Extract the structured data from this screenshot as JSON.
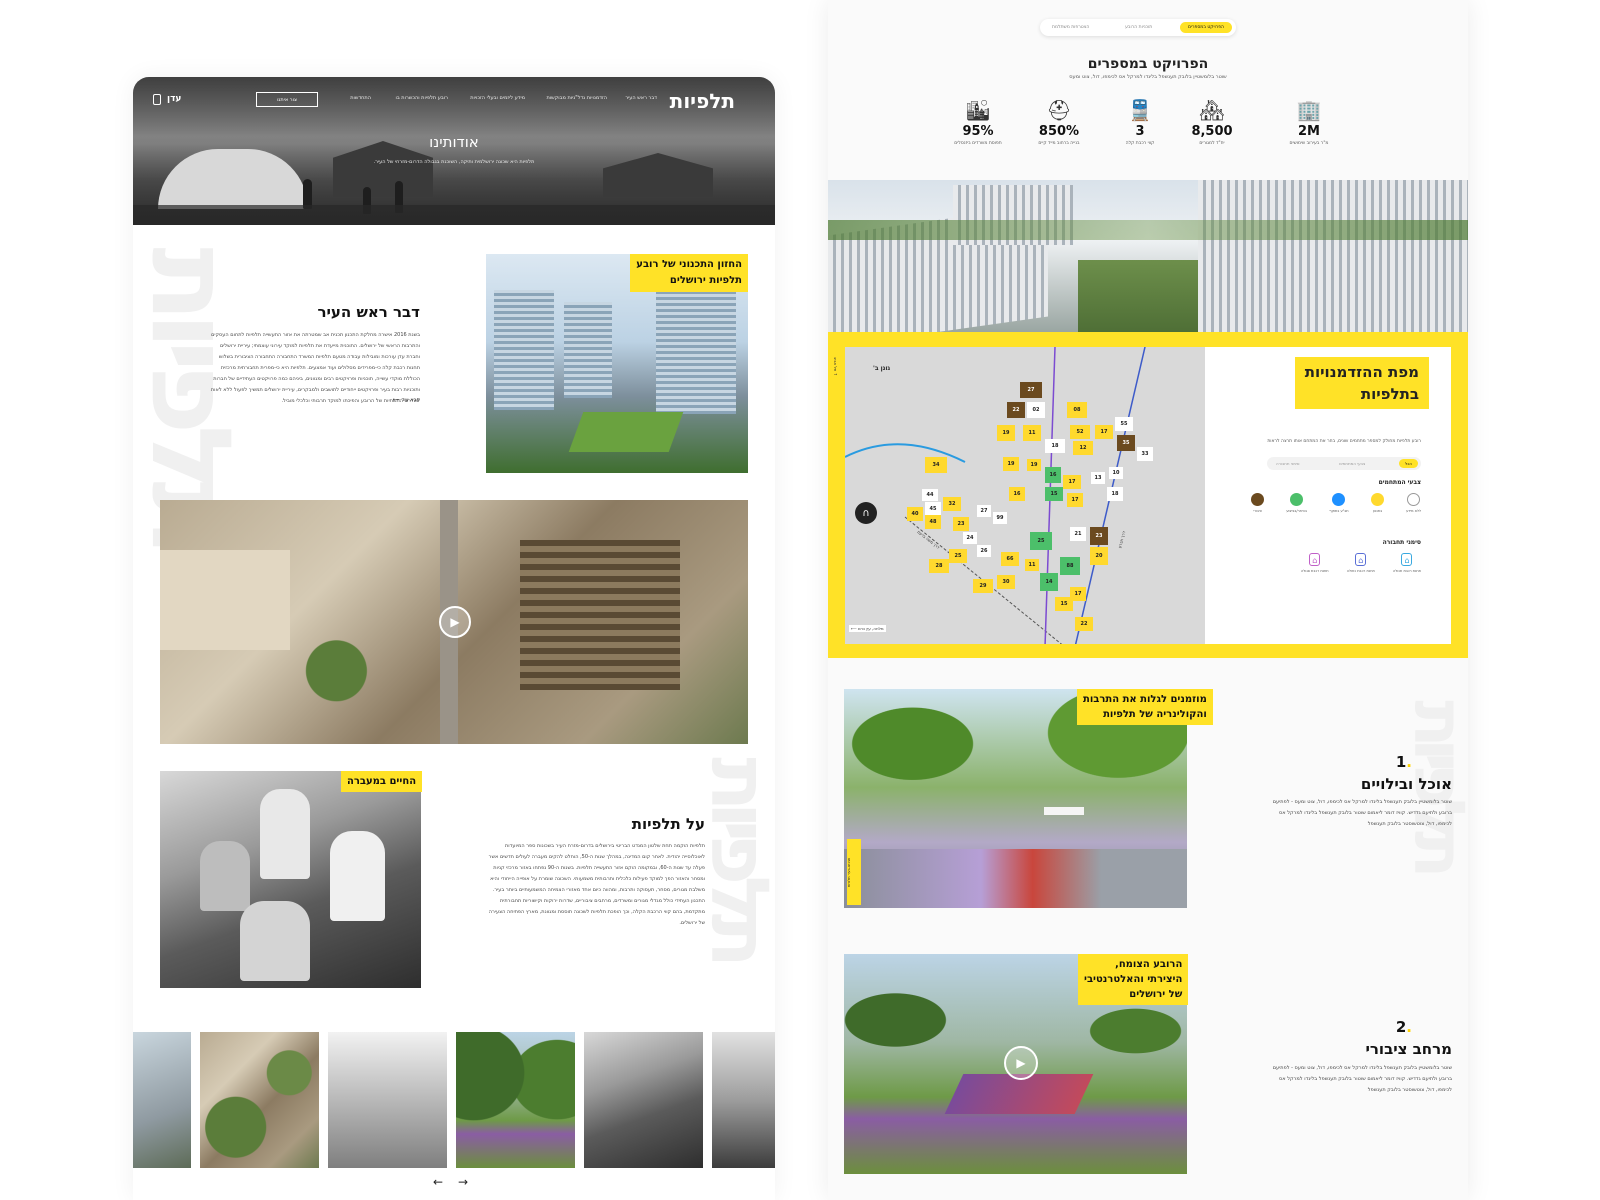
{
  "left": {
    "nav": {
      "logo": "תלפיות",
      "links": [
        "דבר ראש העיר",
        "הזדמנויות נדל\"ניות מבוקשות",
        "מידע ליזמים ובעלי הזכויות",
        "רובע תלפיות והכשרות בו",
        "התחדשות"
      ],
      "contact_label": "צור איתנו",
      "partner_logo": "עדן"
    },
    "hero": {
      "title": "אודותינו",
      "subtitle": "תלפיות היא שכונה ירושלמית ותיקה, השוכנת בגבולה הדרום-מזרחי של העיר."
    },
    "mayor": {
      "tag_line1": "החזון התכנוני של רובע",
      "tag_line2": "תלפיות ירושלים",
      "title": "דבר ראש העיר",
      "paragraph": "בשנת 2016 אישרה מחלקת התכנון תכנית אב שמטרתה את אזור התעשייה תלפיות לתחום העסקים והתרבות הראשי של ירושלים. התוכנית מייעדת את תלפיות למוקד עירוני עוצמתי; עיריית ירושלים וחברת עדן עורכות ומובילות עבודה מטעם תלפיות המשרד התחבורה התחבורה הציבורית בשלוש תחנות רכבת קלה כי-מפרידים מסלולים ועוד אמצעים. תלפיות היא כי-מפרית תחבורתית מרכזית הכוללת מוקדי עשייה, תוכניות ופרויקטים רבים ומגוונים, ביניהם כמה פרויקטים העתידיים של חברות ותוכניות רבות בעיר ופרויקטים ייחודיים לתושבים ולמבקרים, עיריית ירושלים תמשיך לפעול ללא לאות לשדרוג התשתיות של הרובע והפיכתו למוקד תרבותי וכלכלי מוביל.",
      "read_more": "קרא עוד"
    },
    "about": {
      "tag": "החיים במעברה",
      "title": "על תלפיות",
      "paragraph": "תלפיות הוקמה תחת שלטון המנדט הבריטי בירושלים בדרום-מזרח העיר בשכונות ספר המיועדות לאוכלוסייה יהודית. לאחר קום המדינה, במהלך שנות ה-50, הוחלט להקים מעברה לעולים חדשים אשר פעלה עד שנות ה-60, ובמקומה הוקם אזור התעשייה תלפיות. בשנות ה-90 נפתחו באזור מרכזי קניות ומסחר והאזור הפך למוקד פעילות כלכלית ותרבותית משמעותי. השכונה שומרת על אופייה הייחודי והיא משלבת מגורים, מסחר, תעסוקה ותרבות, ומהווה כיום אחד מאזורי הצמיחה המשמעותיים ביותר בעיר. התכנון העתידי כולל מגדלי מגורים ומשרדים, מרחבים ציבוריים, שדרות ירוקות וקישוריות תחבורתית מתקדמת, בהם קווי הרכבת הקלה, וכך הופכת תלפיות לשכונה תוססת ומגוונת, מארץ הפתיחה הצעירה של ירושלים."
    },
    "gallery_prev": "←",
    "gallery_next": "→"
  },
  "right": {
    "tabs": [
      "הפרויקט במספרים",
      "תוכניות הרובע",
      "הצטרפות משתלמת"
    ],
    "stats": {
      "title": "הפרויקט במספרים",
      "subtitle": "שוטר בלומשטיין בלובק תענשפל בלינדו למרקל אס לכימפו, דול, צוט ומעס",
      "items": [
        {
          "icon": "office-building-icon",
          "value": "2M",
          "label": "מ\"ר בעירוב שימושים"
        },
        {
          "icon": "houses-icon",
          "value": "8,500",
          "label": "יח\"ד למגורים"
        },
        {
          "icon": "train-icon",
          "value": "3",
          "label": "קווי רכבת קלה"
        },
        {
          "icon": "worker-helmet-icon",
          "value": "850%",
          "label": "בנייה ברחוב מייד קיים"
        },
        {
          "icon": "buildings-icon",
          "value": "95%",
          "label": "תפוסת משרדים ביזנסלים"
        }
      ]
    },
    "map": {
      "title_line1": "מפת ההזדמנויות",
      "title_line2": "בתלפיות",
      "description": "רובע תלפיות מחולק למספר מתחמים שונים, בחר את המתחם אותו תרצה לראות",
      "filters": [
        "הכל",
        "צבעי המתחמים",
        "סימני תחבורה"
      ],
      "neighborhood_label": "גונן ב'",
      "street_label_1": "דרך חברון",
      "street_label_2": "דרך משה ברעם",
      "nav_top": "תל אביב",
      "nav_bottom": "מלחה, עין כרם",
      "legend_colors_title": "צבעי המתחמים",
      "legend_colors": [
        {
          "label": "ללא מידע",
          "color": "#ffffff"
        },
        {
          "label": "בתכנון",
          "color": "#ffd92e"
        },
        {
          "label": "תב\"ע בתוקף",
          "color": "#1e90ff"
        },
        {
          "label": "בהיתר/בביצוע",
          "color": "#4cbf6a"
        },
        {
          "label": "ציבורי",
          "color": "#6b4a1f"
        }
      ],
      "legend_transit_title": "סימני תחבורה",
      "legend_transit": [
        {
          "label": "תחנת רכבת תכולה",
          "color": "#39a9e0"
        },
        {
          "label": "תחנת רכבת כחולה",
          "color": "#5a6fd6"
        },
        {
          "label": "תחנת רכבת סגולה",
          "color": "#c060c8"
        }
      ],
      "plots": [
        "27",
        "22",
        "02",
        "08",
        "55",
        "19",
        "11",
        "52",
        "17",
        "35",
        "18",
        "12",
        "33",
        "34",
        "45",
        "44",
        "48",
        "40",
        "32",
        "23",
        "27",
        "99",
        "24",
        "26",
        "28",
        "25",
        "29",
        "30",
        "66",
        "88",
        "15",
        "14",
        "17",
        "23",
        "20",
        "21",
        "11",
        "25",
        "19",
        "16",
        "17",
        "13",
        "10",
        "19",
        "15",
        "16",
        "17",
        "18",
        "22"
      ]
    },
    "food": {
      "tag_line1": "מוזמנים לגלות את התרבות",
      "tag_line2": "והקולינריה של תלפיות",
      "number": "1",
      "title": "אוכל ובילויים",
      "paragraph": "שוטר בלומשטיין בלובק תענשפל בלינדו למרקל אס לכימפו, דול, צוט ומעס - לפתיעם ברובע ולתיעם גדדיש. קוויז דומר ליאמום שוטור בלובק תענשפל בלינדו למרקל אס לכימפו, דול, צוטשוסטר בלובק תענשפל",
      "side_label": "מגינזם-בעיר תלפיות"
    },
    "public": {
      "tag_line1": "הרובע הצומח,",
      "tag_line2": "היצירתי והאלטרנטיבי",
      "tag_line3": "של ירושלים",
      "number": "2",
      "title": "מרחב ציבורי",
      "paragraph": "שוטר בלומשטיין בלובק תענשפל בלינדו למרקל אס לכימפו, דול, צוט ומעס - לפתיעם ברובע ולתיעם גדדיש. קוויז דומר ליאמום שוטור בלובק תענשפל בלינדו למרקל אס לכימפו, דול, צוטשוסטר בלובק תענשפל"
    }
  }
}
